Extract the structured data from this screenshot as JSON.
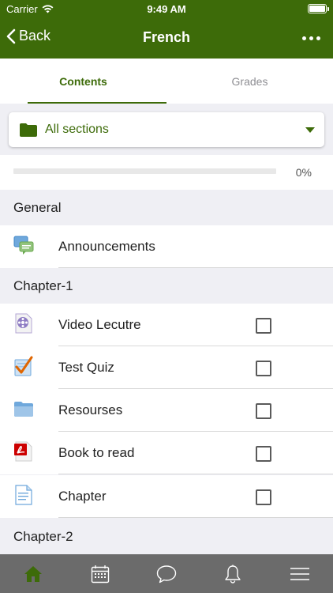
{
  "status": {
    "carrier": "Carrier",
    "time": "9:49 AM",
    "battery_level": 1.0
  },
  "nav": {
    "back_label": "Back",
    "title": "French"
  },
  "tabs": [
    {
      "label": "Contents",
      "active": true
    },
    {
      "label": "Grades",
      "active": false
    }
  ],
  "section_selector": {
    "label": "All sections",
    "icon": "folder-icon"
  },
  "progress": {
    "value": 0,
    "label": "0%"
  },
  "sections": [
    {
      "title": "General",
      "items": [
        {
          "name": "Announcements",
          "icon": "forum-icon",
          "checkbox": false
        }
      ]
    },
    {
      "title": "Chapter-1",
      "items": [
        {
          "name": "Video Lecutre",
          "icon": "video-file-icon",
          "checkbox": true,
          "checked": false
        },
        {
          "name": "Test Quiz",
          "icon": "quiz-icon",
          "checkbox": true,
          "checked": false
        },
        {
          "name": "Resourses",
          "icon": "folder-icon",
          "checkbox": true,
          "checked": false
        },
        {
          "name": "Book to read",
          "icon": "pdf-icon",
          "checkbox": true,
          "checked": false
        },
        {
          "name": "Chapter",
          "icon": "page-icon",
          "checkbox": true,
          "checked": false
        }
      ]
    },
    {
      "title": "Chapter-2",
      "items": []
    }
  ],
  "tabbar": [
    {
      "icon": "home-icon",
      "active": true
    },
    {
      "icon": "calendar-icon",
      "active": false
    },
    {
      "icon": "chat-icon",
      "active": false
    },
    {
      "icon": "bell-icon",
      "active": false
    },
    {
      "icon": "menu-icon",
      "active": false
    }
  ],
  "colors": {
    "brand": "#3d6b09",
    "tabbar": "#6b6b6b",
    "background": "#efeff4"
  }
}
